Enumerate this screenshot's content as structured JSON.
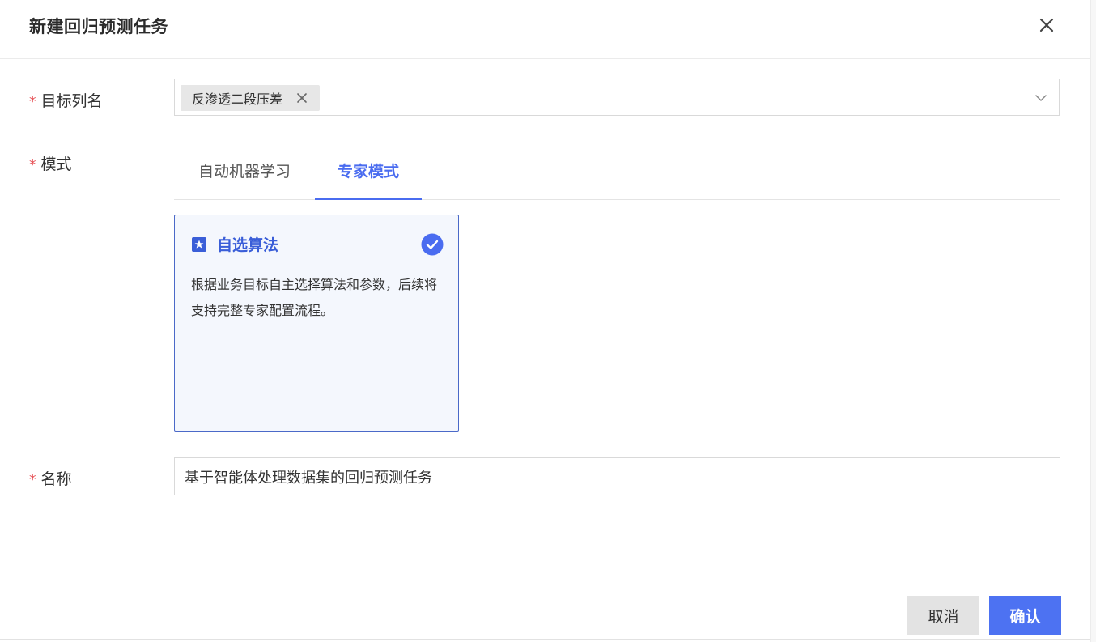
{
  "dialog": {
    "title": "新建回归预测任务"
  },
  "form": {
    "target_column": {
      "label": "目标列名",
      "required_mark": "*",
      "selected_tags": [
        "反渗透二段压差"
      ]
    },
    "mode": {
      "label": "模式",
      "required_mark": "*",
      "tabs": [
        {
          "label": "自动机器学习",
          "active": false
        },
        {
          "label": "专家模式",
          "active": true
        }
      ],
      "card": {
        "title": "自选算法",
        "description": "根据业务目标自主选择算法和参数，后续将支持完整专家配置流程。",
        "selected": true,
        "icon": "star-square-icon"
      }
    },
    "name": {
      "label": "名称",
      "required_mark": "*",
      "value": "基于智能体处理数据集的回归预测任务"
    }
  },
  "footer": {
    "cancel_label": "取消",
    "confirm_label": "确认"
  },
  "colors": {
    "accent": "#4a6cf0",
    "required": "#e5484d",
    "card_border": "#4b69c8",
    "card_bg": "#f4f7fd"
  }
}
